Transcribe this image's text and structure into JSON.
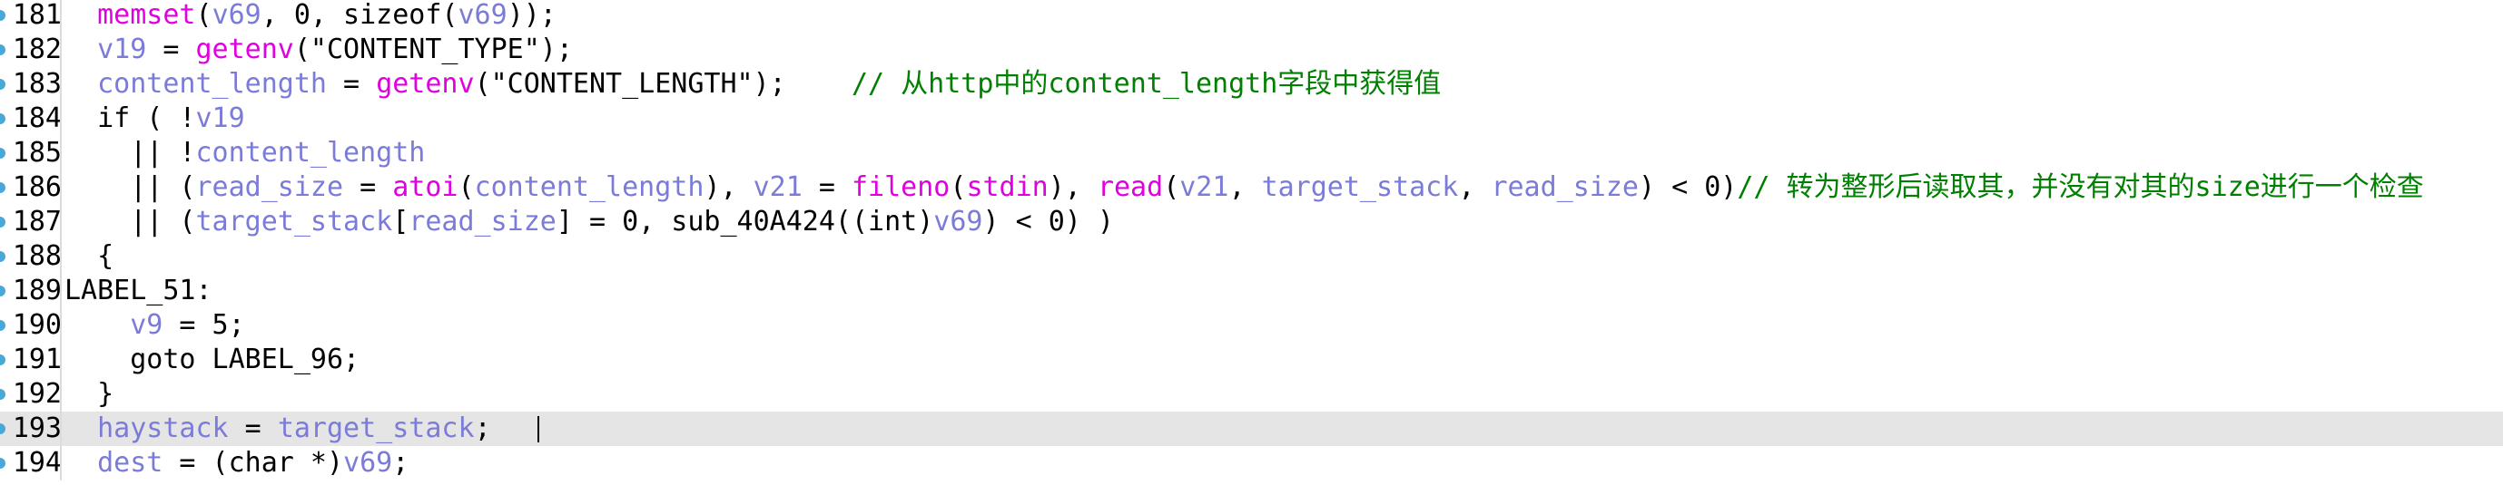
{
  "editor": {
    "current_line": "193",
    "colors": {
      "function": "#e000e0",
      "variable": "#7b7bd8",
      "comment": "#008000",
      "plain": "#000000",
      "current_line_bg": "#e5e5e5",
      "gutter_marker": "#4aa8d8"
    },
    "lines": [
      {
        "number": "181",
        "tokens": [
          {
            "t": "  ",
            "c": "plain"
          },
          {
            "t": "memset",
            "c": "func"
          },
          {
            "t": "(",
            "c": "plain"
          },
          {
            "t": "v69",
            "c": "var"
          },
          {
            "t": ", 0, sizeof(",
            "c": "plain"
          },
          {
            "t": "v69",
            "c": "var"
          },
          {
            "t": "));",
            "c": "plain"
          }
        ]
      },
      {
        "number": "182",
        "tokens": [
          {
            "t": "  ",
            "c": "plain"
          },
          {
            "t": "v19",
            "c": "var"
          },
          {
            "t": " = ",
            "c": "plain"
          },
          {
            "t": "getenv",
            "c": "func"
          },
          {
            "t": "(\"CONTENT_TYPE\");",
            "c": "plain"
          }
        ]
      },
      {
        "number": "183",
        "tokens": [
          {
            "t": "  ",
            "c": "plain"
          },
          {
            "t": "content_length",
            "c": "var"
          },
          {
            "t": " = ",
            "c": "plain"
          },
          {
            "t": "getenv",
            "c": "func"
          },
          {
            "t": "(\"CONTENT_LENGTH\");    ",
            "c": "plain"
          },
          {
            "t": "// 从http中的content_length字段中获得值",
            "c": "cmt"
          }
        ]
      },
      {
        "number": "184",
        "tokens": [
          {
            "t": "  if ( !",
            "c": "plain"
          },
          {
            "t": "v19",
            "c": "var"
          }
        ]
      },
      {
        "number": "185",
        "tokens": [
          {
            "t": "    || !",
            "c": "plain"
          },
          {
            "t": "content_length",
            "c": "var"
          }
        ]
      },
      {
        "number": "186",
        "tokens": [
          {
            "t": "    || (",
            "c": "plain"
          },
          {
            "t": "read_size",
            "c": "var"
          },
          {
            "t": " = ",
            "c": "plain"
          },
          {
            "t": "atoi",
            "c": "func"
          },
          {
            "t": "(",
            "c": "plain"
          },
          {
            "t": "content_length",
            "c": "var"
          },
          {
            "t": "), ",
            "c": "plain"
          },
          {
            "t": "v21",
            "c": "var"
          },
          {
            "t": " = ",
            "c": "plain"
          },
          {
            "t": "fileno",
            "c": "func"
          },
          {
            "t": "(",
            "c": "plain"
          },
          {
            "t": "stdin",
            "c": "func"
          },
          {
            "t": "), ",
            "c": "plain"
          },
          {
            "t": "read",
            "c": "func"
          },
          {
            "t": "(",
            "c": "plain"
          },
          {
            "t": "v21",
            "c": "var"
          },
          {
            "t": ", ",
            "c": "plain"
          },
          {
            "t": "target_stack",
            "c": "var"
          },
          {
            "t": ", ",
            "c": "plain"
          },
          {
            "t": "read_size",
            "c": "var"
          },
          {
            "t": ") < 0)",
            "c": "plain"
          },
          {
            "t": "// 转为整形后读取其，并没有对其的size进行一个检查",
            "c": "cmt"
          }
        ]
      },
      {
        "number": "187",
        "tokens": [
          {
            "t": "    || (",
            "c": "plain"
          },
          {
            "t": "target_stack",
            "c": "var"
          },
          {
            "t": "[",
            "c": "plain"
          },
          {
            "t": "read_size",
            "c": "var"
          },
          {
            "t": "] = 0, sub_40A424((int)",
            "c": "plain"
          },
          {
            "t": "v69",
            "c": "var"
          },
          {
            "t": ") < 0) )",
            "c": "plain"
          }
        ]
      },
      {
        "number": "188",
        "tokens": [
          {
            "t": "  {",
            "c": "plain"
          }
        ]
      },
      {
        "number": "189",
        "tokens": [
          {
            "t": "LABEL_51:",
            "c": "plain"
          }
        ]
      },
      {
        "number": "190",
        "tokens": [
          {
            "t": "    ",
            "c": "plain"
          },
          {
            "t": "v9",
            "c": "var"
          },
          {
            "t": " = 5;",
            "c": "plain"
          }
        ]
      },
      {
        "number": "191",
        "tokens": [
          {
            "t": "    goto LABEL_96;",
            "c": "plain"
          }
        ]
      },
      {
        "number": "192",
        "tokens": [
          {
            "t": "  }",
            "c": "plain"
          }
        ]
      },
      {
        "number": "193",
        "tokens": [
          {
            "t": "  ",
            "c": "plain"
          },
          {
            "t": "haystack",
            "c": "var"
          },
          {
            "t": " = ",
            "c": "plain"
          },
          {
            "t": "target_stack",
            "c": "var"
          },
          {
            "t": ";",
            "c": "plain"
          }
        ]
      },
      {
        "number": "194",
        "tokens": [
          {
            "t": "  ",
            "c": "plain"
          },
          {
            "t": "dest",
            "c": "var"
          },
          {
            "t": " = (char *)",
            "c": "plain"
          },
          {
            "t": "v69",
            "c": "var"
          },
          {
            "t": ";",
            "c": "plain"
          }
        ]
      }
    ]
  }
}
